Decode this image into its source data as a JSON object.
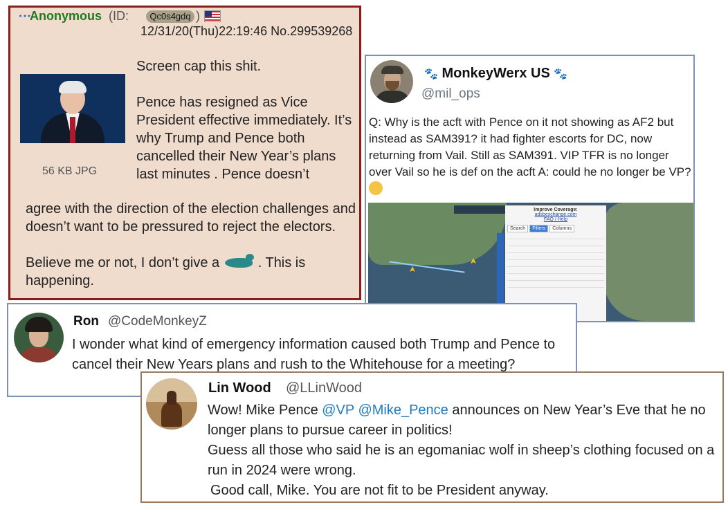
{
  "post": {
    "poster_name": "Anonymous",
    "id_open": "(ID:",
    "poster_id": "Qc0s4gdq",
    "id_close": ")",
    "date": "12/31/20(Thu)22:19:46",
    "post_number": "No.299539268",
    "file_info": "56 KB JPG",
    "line1": "Screen cap this shit.",
    "para_right": "Pence has resigned as Vice President effective immediately. It’s why Trump and Pence both cancelled their New Year’s plans last minutes . Pence doesn’t",
    "para_full": "agree with the direction of the election challenges and doesn’t want to be pressured to reject the electors.",
    "closing_before": "Believe me or not, I don’t give a",
    "closing_after": ". This is happening."
  },
  "monkeywerx": {
    "name": "MonkeyWerx US",
    "handle": "@mil_ops",
    "text": "Q: Why is the acft with Pence on it not showing as AF2 but instead as SAM391? it had fighter escorts for DC, now returning from Vail. Still as SAM391. VIP TFR is no longer over Vail so he is def on the acft A: could he no longer be VP?",
    "emoji": "thinking-face",
    "map": {
      "panel_title": "Improve Coverage:",
      "panel_site": "adsbexchange.com",
      "panel_link": "FAQ / Help",
      "tabs": [
        "Search",
        "Filters",
        "Columns"
      ],
      "active_tab": "Filters"
    }
  },
  "ron": {
    "name": "Ron",
    "handle": "@CodeMonkeyZ",
    "text": "I wonder what kind of emergency information caused both Trump and Pence to cancel their New Years plans and rush to the Whitehouse for a meeting?"
  },
  "lin": {
    "name": "Lin Wood",
    "handle": "@LLinWood",
    "text_before": "Wow! Mike Pence ",
    "mention1": "@VP",
    "mention2": "@Mike_Pence",
    "text_after": " announces on New Year’s Eve that he no longer plans to pursue career in politics!",
    "line2": "Guess all those who said he is an egomaniac wolf in sheep’s clothing focused on a run in 2024 were wrong.",
    "line3": "Good call, Mike. You are not fit to be President anyway."
  }
}
